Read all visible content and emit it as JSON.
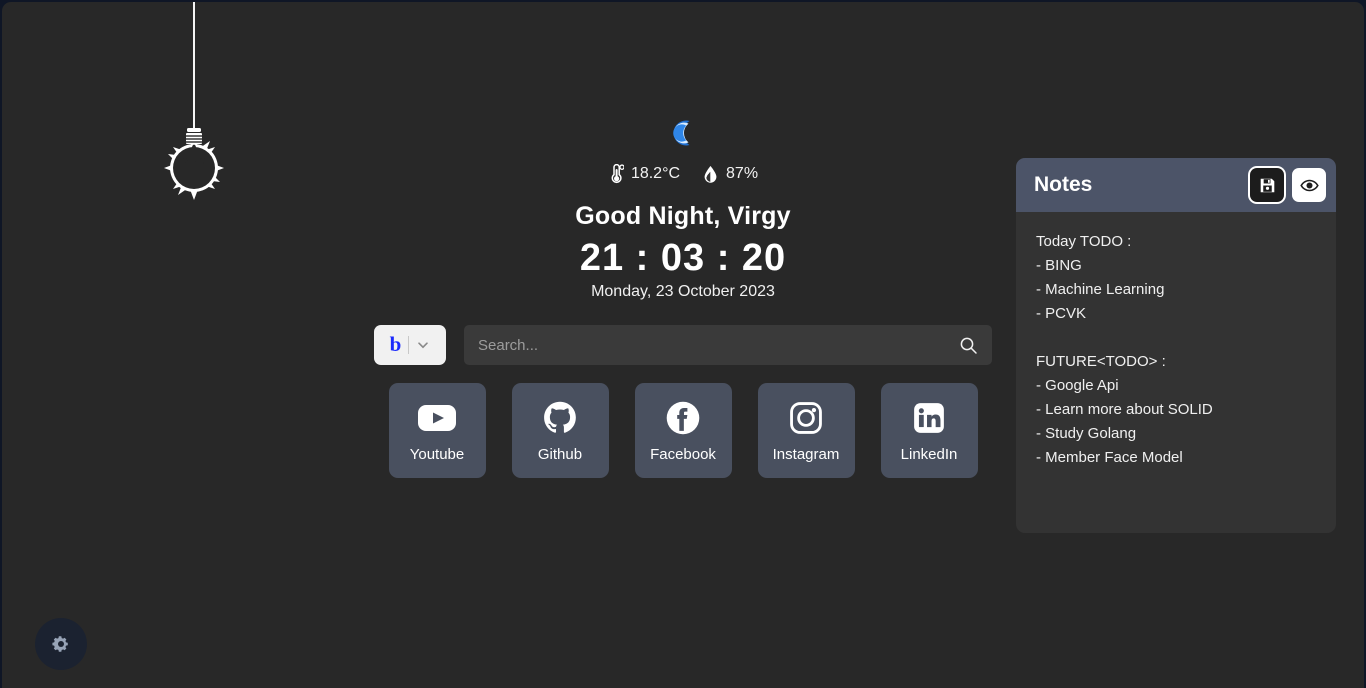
{
  "colors": {
    "page_background": "#282828",
    "outer_border": "#0f1626",
    "tile_background": "#49505f",
    "notes_header": "#4c5468",
    "notes_body": "#333333",
    "bing_blue": "#1b2afc",
    "moon_blue": "#1f6fd0",
    "settings_button": "#1b2230"
  },
  "lamp": {
    "icon": "hanging-lightbulb-icon"
  },
  "header": {
    "moon_icon": "crescent-moon-icon",
    "weather": {
      "temperature_icon": "thermometer-icon",
      "temperature": "18.2°C",
      "humidity_icon": "water-droplet-icon",
      "humidity": "87%"
    },
    "greeting": "Good Night, Virgy",
    "clock": "21 : 03 : 20",
    "date": "Monday, 23 October 2023"
  },
  "search": {
    "engine_logo": "bing-logo-icon",
    "engine_letter": "b",
    "dropdown_icon": "chevron-down-icon",
    "placeholder": "Search...",
    "value": "",
    "search_icon": "search-icon"
  },
  "shortcuts": [
    {
      "label": "Youtube",
      "icon": "youtube-icon"
    },
    {
      "label": "Github",
      "icon": "github-icon"
    },
    {
      "label": "Facebook",
      "icon": "facebook-icon"
    },
    {
      "label": "Instagram",
      "icon": "instagram-icon"
    },
    {
      "label": "LinkedIn",
      "icon": "linkedin-icon"
    }
  ],
  "notes": {
    "title": "Notes",
    "save_icon": "floppy-disk-save-icon",
    "preview_icon": "eye-preview-icon",
    "content": "Today TODO :\n- BING\n- Machine Learning\n- PCVK\n\nFUTURE<TODO> :\n- Google Api\n- Learn more about SOLID\n- Study Golang\n- Member Face Model"
  },
  "settings": {
    "icon": "gear-icon"
  }
}
